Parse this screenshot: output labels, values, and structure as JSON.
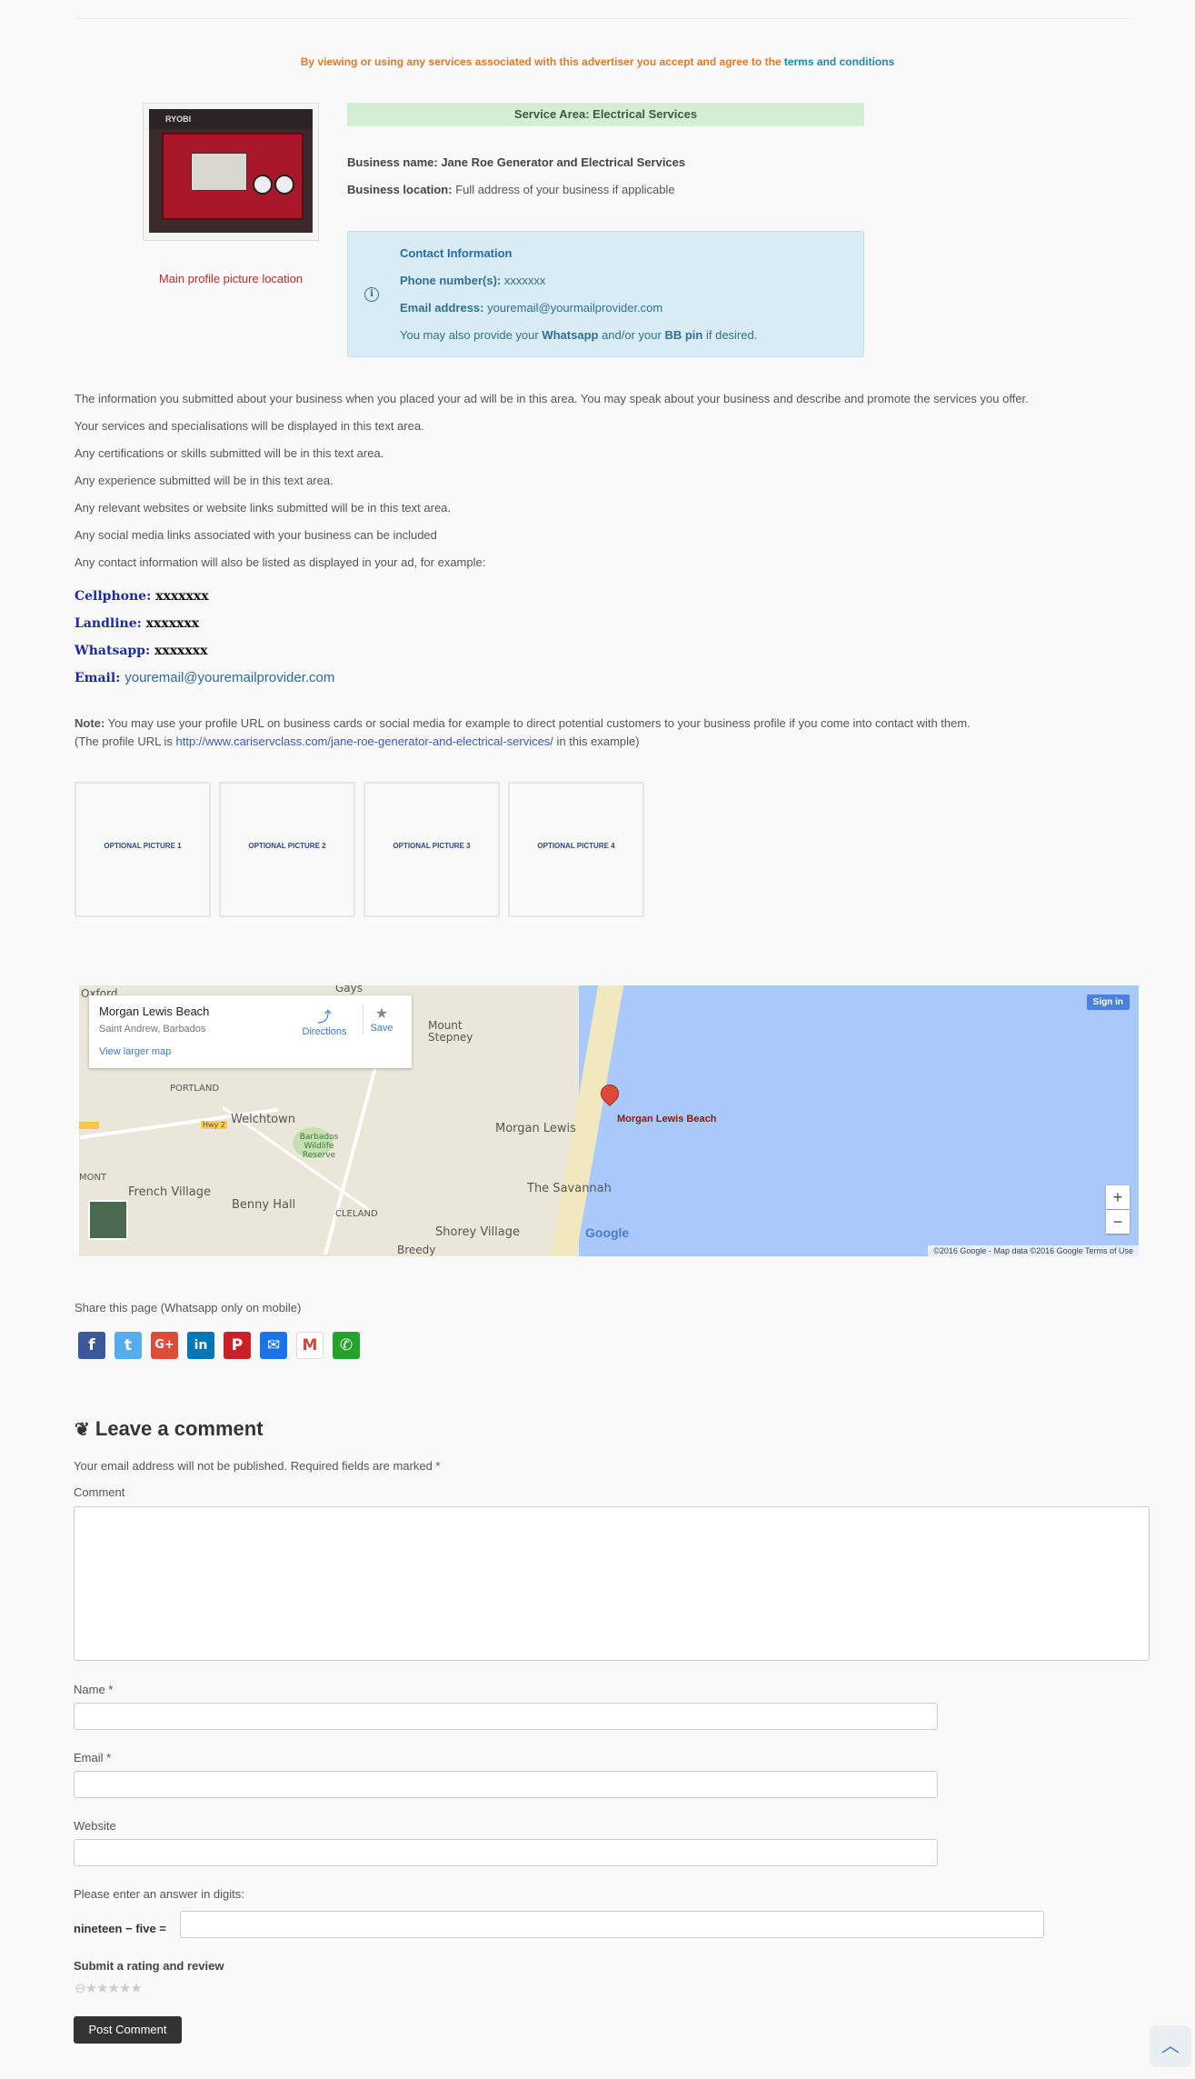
{
  "notice": {
    "text": "By viewing or using any services associated with this advertiser you accept and agree to the ",
    "link": "terms and conditions"
  },
  "profile": {
    "brand": "RYOBI",
    "caption": "Main profile picture location"
  },
  "service_area": "Service Area: Electrical Services",
  "business": {
    "name_label": "Business name:",
    "name_value": "Jane Roe Generator and Electrical Services",
    "location_label": "Business location:",
    "location_value": "Full address of your business if applicable"
  },
  "contact": {
    "title": "Contact Information",
    "phone_label": "Phone number(s):",
    "phone_value": "xxxxxxx",
    "email_label": "Email address:",
    "email_value": "youremail@yourmailprovider.com",
    "extra_pre": "You may also provide your ",
    "extra_whatsapp": "Whatsapp",
    "extra_mid": " and/or your ",
    "extra_bbpin": "BB pin",
    "extra_post": " if desired."
  },
  "description": [
    "The information you submitted about your business when you placed your ad will be in this area. You may speak about your business and describe and promote the services you offer.",
    "Your services and specialisations will be displayed in this text area.",
    "Any certifications or skills submitted will be in this text area.",
    "Any experience submitted will be in this text area.",
    "Any relevant websites or website links submitted will be in this text area.",
    "Any social media links associated with your business can be included",
    "Any contact information will also be listed as displayed in your ad, for example:"
  ],
  "contact_list": {
    "cell_label": "Cellphone:",
    "cell_value": "xxxxxxx",
    "land_label": "Landline:",
    "land_value": "xxxxxxx",
    "wa_label": "Whatsapp:",
    "wa_value": "xxxxxxx",
    "email_label": "Email:",
    "email_value": "youremail@youremailprovider.com"
  },
  "note": {
    "label": "Note:",
    "text": " You may use your profile URL on business cards or social media for example to direct potential customers to your business profile if you come into contact with them.",
    "url_pre": "(The profile URL is ",
    "url": "http://www.cariservclass.com/jane-roe-generator-and-electrical-services/",
    "url_post": " in this example)"
  },
  "pictures": [
    "OPTIONAL PICTURE 1",
    "OPTIONAL PICTURE 2",
    "OPTIONAL PICTURE 3",
    "OPTIONAL PICTURE 4"
  ],
  "map": {
    "place": "Morgan Lewis Beach",
    "region": "Saint Andrew, Barbados",
    "larger": "View larger map",
    "directions": "Directions",
    "save": "Save",
    "signin": "Sign in",
    "pin_label": "Morgan Lewis Beach",
    "labels": {
      "oxford": "Oxford",
      "gays": "Gays",
      "mount_stepney": "Mount\nStepney",
      "portland": "PORTLAND",
      "welchtown": "Welchtown",
      "hwy": "Hwy 2",
      "barbados_wildlife": "Barbados\nWildlife\nReserve",
      "morgan_lewis": "Morgan Lewis",
      "mont": "MONT",
      "french_village": "French Village",
      "benny_hall": "Benny Hall",
      "the_savannah": "The Savannah",
      "cleland": "CLELAND",
      "shorey_village": "Shorey Village",
      "breedy": "Breedy"
    },
    "google": "Google",
    "footer": "©2016 Google - Map data ©2016 Google   Terms of Use"
  },
  "share": {
    "label": "Share this page (Whatsapp only on mobile)",
    "buttons": [
      {
        "icon": "facebook-icon",
        "glyph": "f",
        "color": "#3b5998"
      },
      {
        "icon": "twitter-icon",
        "glyph": "t",
        "color": "#55acee"
      },
      {
        "icon": "google-plus-icon",
        "glyph": "G+",
        "color": "#dd4b39"
      },
      {
        "icon": "linkedin-icon",
        "glyph": "in",
        "color": "#0077b5"
      },
      {
        "icon": "pinterest-icon",
        "glyph": "P",
        "color": "#cb2027"
      },
      {
        "icon": "email-icon",
        "glyph": "✉",
        "color": "#1a73e8"
      },
      {
        "icon": "gmail-icon",
        "glyph": "M",
        "color": "#ffffff"
      },
      {
        "icon": "whatsapp-icon",
        "glyph": "✆",
        "color": "#25a22a"
      }
    ]
  },
  "comment": {
    "title": "Leave a comment",
    "notice": "Your email address will not be published. Required fields are marked *",
    "comment_label": "Comment",
    "name_label": "Name *",
    "email_label": "Email *",
    "website_label": "Website",
    "captcha_prompt": "Please enter an answer in digits:",
    "captcha_question": "nineteen − five =",
    "rating_label": "Submit a rating and review",
    "stars": "⊖★★★★★",
    "submit": "Post Comment"
  },
  "back_to_top": "︿"
}
